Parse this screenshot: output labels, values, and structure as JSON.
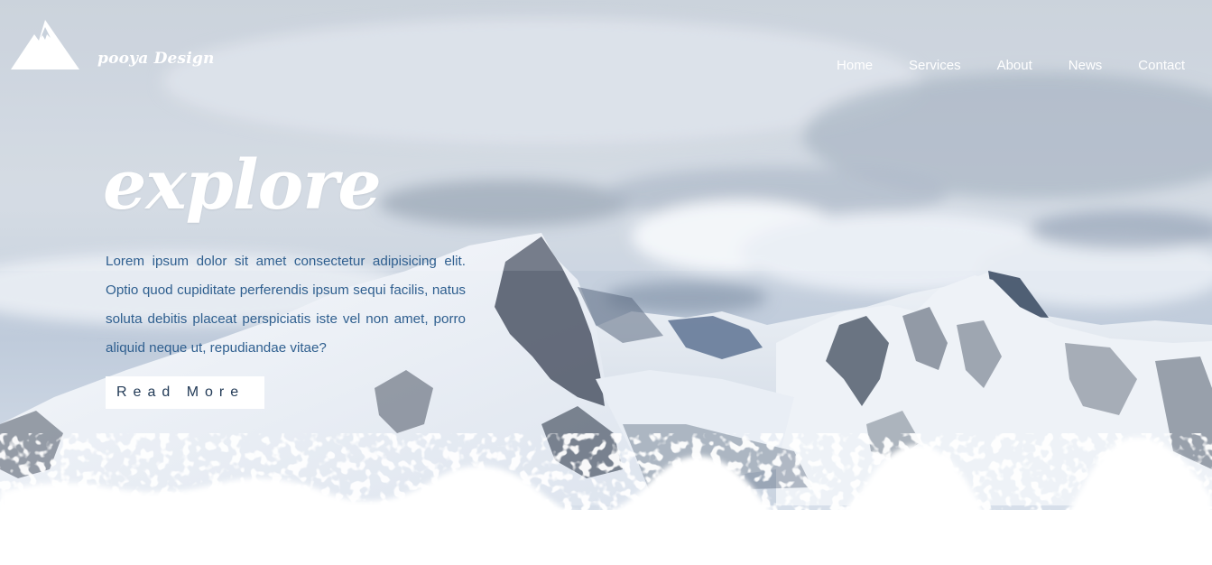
{
  "brand": {
    "logo_icon": "mountain-icon",
    "name": "pooya Design"
  },
  "nav": {
    "items": [
      "Home",
      "Services",
      "About",
      "News",
      "Contact"
    ]
  },
  "hero": {
    "headline": "explore",
    "body": "Lorem ipsum dolor sit amet consectetur adipisicing elit. Optio quod cupiditate perferendis ipsum sequi facilis, natus soluta debitis placeat perspiciatis iste vel non amet, porro aliquid neque ut, repudiandae vitae?",
    "button_label": "Read More"
  },
  "colors": {
    "text_white": "#ffffff",
    "body_text": "#2f5f8f",
    "button_text": "#233b57",
    "sky_top": "#c7d0dc",
    "sky_blue": "#a9bbd3",
    "rock_dark": "#4e5867",
    "snow": "#f4f7fb"
  }
}
